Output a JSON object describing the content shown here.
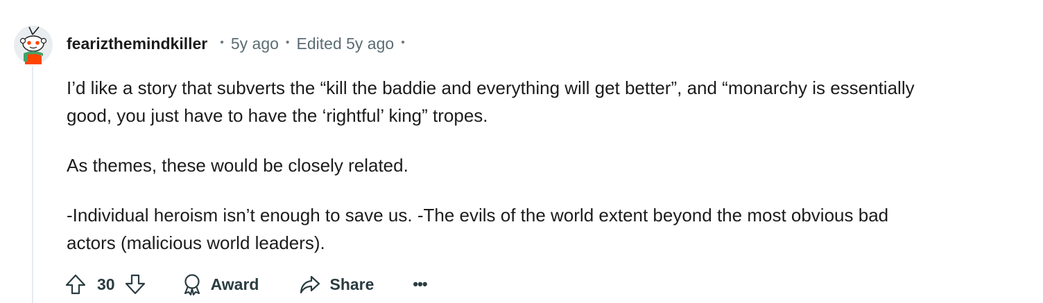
{
  "comment": {
    "author": "fearizthemindkiller",
    "posted": "5y ago",
    "edited": "Edited 5y ago",
    "paragraphs": [
      "I’d like a story that subverts the “kill the baddie and everything will get better”, and “monarchy is essentially",
      "good, you just have to have the ‘rightful’ king” tropes.",
      "As themes, these would be closely related.",
      "-Individual heroism isn’t enough to save us. -The evils of the world extent beyond the most obvious bad",
      "actors (malicious world leaders)."
    ]
  },
  "actions": {
    "score": "30",
    "award_label": "Award",
    "share_label": "Share",
    "more_label": "•••"
  },
  "icons": {
    "avatar": "snoo-avatar-icon",
    "upvote": "upvote-arrow-icon",
    "downvote": "downvote-arrow-icon",
    "award": "award-ribbon-icon",
    "share": "share-arrow-icon"
  },
  "colors": {
    "text": "#1c1c1c",
    "meta": "#5c6c74",
    "thread_line": "#e5ebee",
    "avatar_bg": "#e9edf0",
    "avatar_accent": "#ff4500",
    "avatar_scarf": "#46a06a"
  }
}
